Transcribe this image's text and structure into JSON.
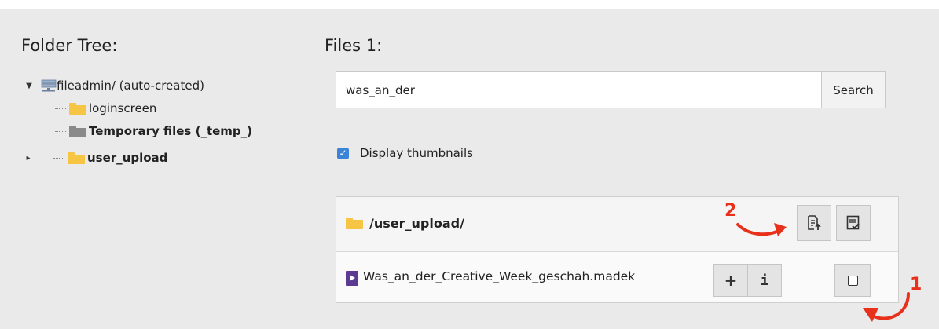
{
  "folder_tree": {
    "title": "Folder Tree:",
    "root": {
      "label": "fileadmin/ (auto-created)",
      "expanded": true
    },
    "children": [
      {
        "label": "loginscreen",
        "bold": false,
        "folder_color": "yellow"
      },
      {
        "label": "Temporary files (_temp_)",
        "bold": true,
        "folder_color": "gray"
      },
      {
        "label": "user_upload",
        "bold": true,
        "folder_color": "yellow",
        "collapsed": true
      }
    ]
  },
  "files": {
    "title": "Files 1:",
    "search": {
      "value": "was_an_der",
      "button_label": "Search"
    },
    "display_thumbnails": {
      "label": "Display thumbnails",
      "checked": true
    },
    "folder_row": {
      "path": "/user_upload/"
    },
    "file_row": {
      "name": "Was_an_der_Creative_Week_geschah.madek",
      "add_label": "+",
      "info_label": "i"
    }
  },
  "annotations": {
    "marker_1": "1",
    "marker_2": "2"
  },
  "colors": {
    "accent": "#3a83d6",
    "annotation": "#e8311b",
    "folder": "#f6c544",
    "file_icon": "#5b3a91"
  }
}
